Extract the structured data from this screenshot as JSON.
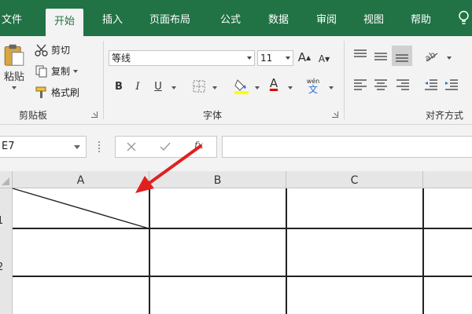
{
  "tabs": [
    {
      "label": "文件"
    },
    {
      "label": "开始",
      "active": true
    },
    {
      "label": "插入"
    },
    {
      "label": "页面布局"
    },
    {
      "label": "公式"
    },
    {
      "label": "数据"
    },
    {
      "label": "审阅"
    },
    {
      "label": "视图"
    },
    {
      "label": "帮助"
    }
  ],
  "clipboard": {
    "paste_label": "粘贴",
    "cut_label": "剪切",
    "copy_label": "复制",
    "format_painter_label": "格式刷",
    "group_label": "剪贴板"
  },
  "font": {
    "name": "等线",
    "size": "11",
    "bold": "B",
    "italic": "I",
    "underline": "U",
    "grow": "A",
    "shrink": "A",
    "font_color_letter": "A",
    "phonetic_top": "wén",
    "phonetic_bottom": "文",
    "group_label": "字体"
  },
  "alignment": {
    "group_label": "对齐方式"
  },
  "formula_bar": {
    "name_box": "E7",
    "fx_label": "fx",
    "formula": ""
  },
  "columns": [
    "A",
    "B",
    "C"
  ],
  "rows": [
    "1",
    "2"
  ],
  "colors": {
    "accent": "#217346",
    "fill_highlight": "#ffff00",
    "font_color": "#e00000",
    "arrow": "#e02020"
  }
}
